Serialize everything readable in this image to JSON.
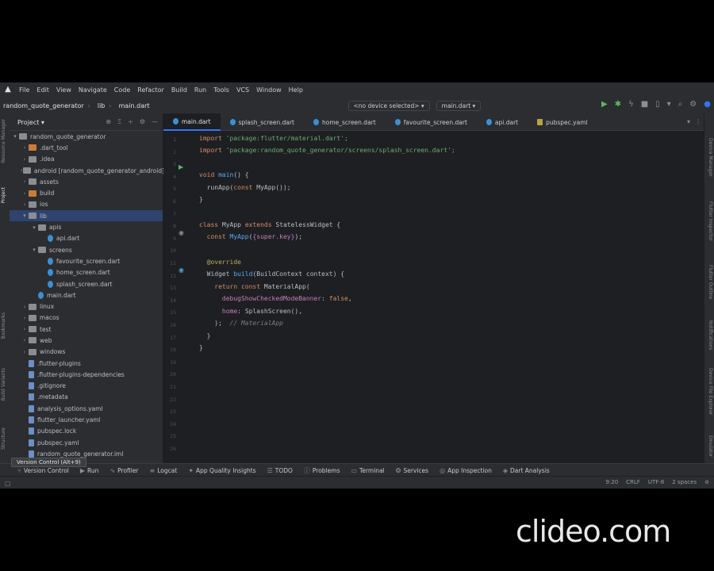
{
  "menu": [
    "File",
    "Edit",
    "View",
    "Navigate",
    "Code",
    "Refactor",
    "Build",
    "Run",
    "Tools",
    "VCS",
    "Window",
    "Help"
  ],
  "toolbar": {
    "project_name": "random_quote_generator",
    "folder": "lib",
    "file": "main.dart",
    "device": "<no device selected>",
    "run_config": "main.dart"
  },
  "project_panel": {
    "title": "Project",
    "items": [
      {
        "label": "random_quote_generator",
        "depth": 0,
        "kind": "folder",
        "expanded": true
      },
      {
        "label": ".dart_tool",
        "depth": 1,
        "kind": "folder-orange"
      },
      {
        "label": ".idea",
        "depth": 1,
        "kind": "folder"
      },
      {
        "label": "android [random_quote_generator_android]",
        "depth": 1,
        "kind": "folder"
      },
      {
        "label": "assets",
        "depth": 1,
        "kind": "folder"
      },
      {
        "label": "build",
        "depth": 1,
        "kind": "folder-orange"
      },
      {
        "label": "ios",
        "depth": 1,
        "kind": "folder"
      },
      {
        "label": "lib",
        "depth": 1,
        "kind": "folder",
        "expanded": true,
        "selected": true
      },
      {
        "label": "apis",
        "depth": 2,
        "kind": "folder",
        "expanded": true
      },
      {
        "label": "api.dart",
        "depth": 3,
        "kind": "dart"
      },
      {
        "label": "screens",
        "depth": 2,
        "kind": "folder",
        "expanded": true
      },
      {
        "label": "favourite_screen.dart",
        "depth": 3,
        "kind": "dart"
      },
      {
        "label": "home_screen.dart",
        "depth": 3,
        "kind": "dart"
      },
      {
        "label": "splash_screen.dart",
        "depth": 3,
        "kind": "dart"
      },
      {
        "label": "main.dart",
        "depth": 2,
        "kind": "dart"
      },
      {
        "label": "linux",
        "depth": 1,
        "kind": "folder"
      },
      {
        "label": "macos",
        "depth": 1,
        "kind": "folder"
      },
      {
        "label": "test",
        "depth": 1,
        "kind": "folder"
      },
      {
        "label": "web",
        "depth": 1,
        "kind": "folder"
      },
      {
        "label": "windows",
        "depth": 1,
        "kind": "folder"
      },
      {
        "label": ".flutter-plugins",
        "depth": 1,
        "kind": "file"
      },
      {
        "label": ".flutter-plugins-dependencies",
        "depth": 1,
        "kind": "file"
      },
      {
        "label": ".gitignore",
        "depth": 1,
        "kind": "file"
      },
      {
        "label": ".metadata",
        "depth": 1,
        "kind": "file"
      },
      {
        "label": "analysis_options.yaml",
        "depth": 1,
        "kind": "yaml"
      },
      {
        "label": "flutter_launcher.yaml",
        "depth": 1,
        "kind": "yaml"
      },
      {
        "label": "pubspec.lock",
        "depth": 1,
        "kind": "file"
      },
      {
        "label": "pubspec.yaml",
        "depth": 1,
        "kind": "yaml"
      },
      {
        "label": "random_quote_generator.iml",
        "depth": 1,
        "kind": "file"
      }
    ]
  },
  "tabs": [
    {
      "label": "main.dart",
      "kind": "dart",
      "active": true
    },
    {
      "label": "splash_screen.dart",
      "kind": "dart"
    },
    {
      "label": "home_screen.dart",
      "kind": "dart"
    },
    {
      "label": "favourite_screen.dart",
      "kind": "dart"
    },
    {
      "label": "api.dart",
      "kind": "dart"
    },
    {
      "label": "pubspec.yaml",
      "kind": "yaml"
    }
  ],
  "code": {
    "line_numbers": [
      "1",
      "2",
      "3",
      "4",
      "5",
      "6",
      "7",
      "8",
      "9",
      "10",
      "11",
      "12",
      "13",
      "14",
      "15",
      "16",
      "17",
      "18",
      "19",
      "20",
      "21",
      "22",
      "23",
      "24",
      "25",
      "26"
    ],
    "line1_kw": "import",
    "line1_str": " 'package:flutter/material.dart';",
    "line2_kw": "import",
    "line2_str": " 'package:random_quote_generator/screens/splash_screen.dart';",
    "line4_kw": "void",
    "line4_fn": " main",
    "line4_rest": "() {",
    "line5_fn": "  runApp",
    "line5_p": "(",
    "line5_kw": "const",
    "line5_rest": " MyApp());",
    "line6": "}",
    "line8_kw": "class",
    "line8_cls": " MyApp ",
    "line8_kw2": "extends",
    "line8_rest": " StatelessWidget {",
    "line9_kw": "  const",
    "line9_fn": " MyApp",
    "line9_p": "(",
    "line9_pa": "{super.key}",
    "line9_rest": ");",
    "line11_an": "  @override",
    "line12": "  Widget ",
    "line12_fn": "build",
    "line12_rest": "(BuildContext context) {",
    "line13_kw": "    return const",
    "line13_rest": " MaterialApp(",
    "line14_pa": "      debugShowCheckedModeBanner",
    "line14_p": ": ",
    "line14_kw": "false",
    "line14_rest": ",",
    "line15_pa": "      home",
    "line15_p": ": ",
    "line15_rest": "SplashScreen(),",
    "line16": "    ); ",
    "line16_cm": " // MaterialApp",
    "line17": "  }",
    "line18": "}"
  },
  "toolwindows": [
    "Version Control",
    "Run",
    "Profiler",
    "Logcat",
    "App Quality Insights",
    "TODO",
    "Problems",
    "Terminal",
    "Services",
    "App Inspection",
    "Dart Analysis"
  ],
  "tooltip": "Version Control (Alt+9)",
  "status": {
    "position": "9:20",
    "line_sep": "CRLF",
    "encoding": "UTF-8",
    "indent": "2 spaces"
  },
  "left_strip": [
    "Resource Manager",
    "Project",
    "Bookmarks",
    "Build Variants",
    "Structure"
  ],
  "right_strip": [
    "Device Manager",
    "Flutter Inspector",
    "Flutter Outline",
    "Notifications",
    "Device File Explorer",
    "Emulator"
  ],
  "watermark": "clideo.com"
}
